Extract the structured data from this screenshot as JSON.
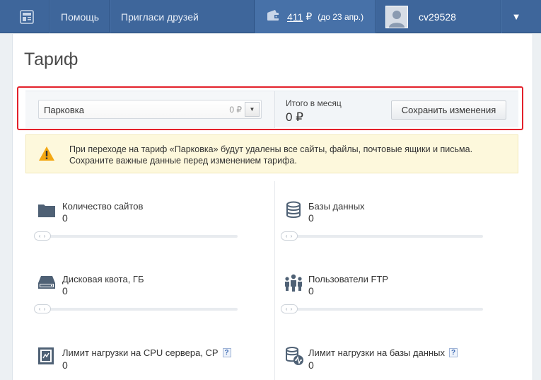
{
  "topbar": {
    "logo_icon": "site-logo-icon",
    "help": "Помощь",
    "invite": "Пригласи друзей",
    "balance": {
      "icon": "wallet-icon",
      "amount": "411",
      "currency": "₽",
      "until": "(до 23 апр.)"
    },
    "user": {
      "avatar_icon": "user-avatar-icon",
      "name": "cv29528"
    },
    "menu_caret": "▼"
  },
  "page": {
    "title": "Тариф"
  },
  "tariff": {
    "selected": "Парковка",
    "price": "0 ₽",
    "total_label": "Итого в месяц",
    "total_value": "0 ₽",
    "save_label": "Сохранить изменения"
  },
  "warning": {
    "icon": "warning-triangle-icon",
    "line1": "При переходе на тариф «Парковка» будут удалены все сайты, файлы, почтовые ящики и письма.",
    "line2": "Сохраните важные данные перед изменением тарифа."
  },
  "stats": [
    {
      "label": "Количество сайтов",
      "value": "0",
      "icon": "folder-icon",
      "help": ""
    },
    {
      "label": "Базы данных",
      "value": "0",
      "icon": "database-icon",
      "help": ""
    },
    {
      "label": "Дисковая квота, ГБ",
      "value": "0",
      "icon": "hard-drive-icon",
      "help": ""
    },
    {
      "label": "Пользователи FTP",
      "value": "0",
      "icon": "users-group-icon",
      "help": ""
    },
    {
      "label": "Лимит нагрузки на CPU сервера, CP",
      "value": "0",
      "icon": "cpu-icon",
      "help": "?"
    },
    {
      "label": "Лимит нагрузки на базы данных",
      "value": "0",
      "icon": "database-load-icon",
      "help": "?"
    }
  ],
  "slider_knob": "‹ ›",
  "colors": {
    "topbar": "#3e669b",
    "balance_bg": "#4771a8",
    "highlight_frame": "#e3212b",
    "warning_bg": "#fdf8dc",
    "icon": "#4f6175"
  }
}
